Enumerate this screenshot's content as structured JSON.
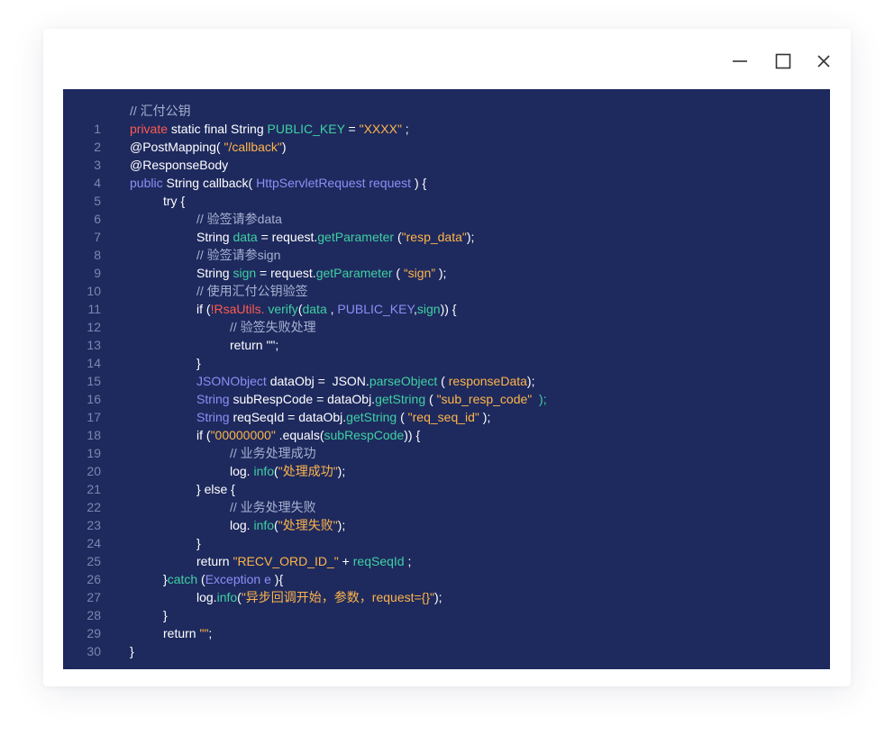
{
  "window": {
    "controls": {
      "minimize": {
        "icon": "minimize-icon"
      },
      "maximize": {
        "icon": "maximize-icon"
      },
      "close": {
        "icon": "close-icon"
      }
    }
  },
  "theme": {
    "editor_bg": "#1e2a5e",
    "plain": "#ffffff",
    "comment": "#a8b0d0",
    "keyword": "#ff5a4e",
    "type": "#8f8df5",
    "function": "#3fd0a2",
    "string": "#ffb44a",
    "line_number": "#7d86ad"
  },
  "code": {
    "lines": [
      {
        "n": "",
        "indent": 0,
        "tokens": [
          {
            "t": "// 汇付公钥",
            "c": "cm"
          }
        ]
      },
      {
        "n": "1",
        "indent": 0,
        "tokens": [
          {
            "t": "private",
            "c": "kw"
          },
          {
            "t": " static final String ",
            "c": "pl"
          },
          {
            "t": "PUBLIC_KEY",
            "c": "fn"
          },
          {
            "t": " = ",
            "c": "pl"
          },
          {
            "t": "\"XXXX\"",
            "c": "str"
          },
          {
            "t": " ;",
            "c": "pl"
          }
        ]
      },
      {
        "n": "2",
        "indent": 0,
        "tokens": [
          {
            "t": "@PostMapping(",
            "c": "pl"
          },
          {
            "t": " \"/callback\"",
            "c": "str"
          },
          {
            "t": ")",
            "c": "pl"
          }
        ]
      },
      {
        "n": "3",
        "indent": 0,
        "tokens": [
          {
            "t": "@ResponseBody",
            "c": "pl"
          }
        ]
      },
      {
        "n": "4",
        "indent": 0,
        "tokens": [
          {
            "t": "public",
            "c": "kw2"
          },
          {
            "t": " String callback( ",
            "c": "pl"
          },
          {
            "t": "HttpServletRequest request",
            "c": "kw2"
          },
          {
            "t": " ) {",
            "c": "pl"
          }
        ]
      },
      {
        "n": "5",
        "indent": 1,
        "tokens": [
          {
            "t": "try {",
            "c": "pl"
          }
        ]
      },
      {
        "n": "6",
        "indent": 2,
        "tokens": [
          {
            "t": "// 验签请参data",
            "c": "cm"
          }
        ]
      },
      {
        "n": "7",
        "indent": 2,
        "tokens": [
          {
            "t": "String ",
            "c": "pl"
          },
          {
            "t": "data",
            "c": "fn"
          },
          {
            "t": " = request.",
            "c": "pl"
          },
          {
            "t": "getParameter",
            "c": "fn"
          },
          {
            "t": " (",
            "c": "pl"
          },
          {
            "t": "\"resp_data\"",
            "c": "str"
          },
          {
            "t": ");",
            "c": "pl"
          }
        ]
      },
      {
        "n": "8",
        "indent": 2,
        "tokens": [
          {
            "t": "// 验签请参sign",
            "c": "cm"
          }
        ]
      },
      {
        "n": "9",
        "indent": 2,
        "tokens": [
          {
            "t": "String ",
            "c": "pl"
          },
          {
            "t": "sign",
            "c": "fn"
          },
          {
            "t": " = request.",
            "c": "pl"
          },
          {
            "t": "getParameter",
            "c": "fn"
          },
          {
            "t": " ( ",
            "c": "pl"
          },
          {
            "t": "“sign”",
            "c": "str"
          },
          {
            "t": " );",
            "c": "pl"
          }
        ]
      },
      {
        "n": "10",
        "indent": 2,
        "tokens": [
          {
            "t": "// 使用汇付公钥验签",
            "c": "cm"
          }
        ]
      },
      {
        "n": "11",
        "indent": 2,
        "tokens": [
          {
            "t": "if (",
            "c": "pl"
          },
          {
            "t": "!RsaUtils.",
            "c": "kw"
          },
          {
            "t": " verify",
            "c": "fn"
          },
          {
            "t": "(",
            "c": "pl"
          },
          {
            "t": "data",
            "c": "fn"
          },
          {
            "t": " , ",
            "c": "pl"
          },
          {
            "t": "PUBLIC_KEY",
            "c": "kw2"
          },
          {
            "t": ",",
            "c": "pl"
          },
          {
            "t": "sign",
            "c": "fn"
          },
          {
            "t": ")) {",
            "c": "pl"
          }
        ]
      },
      {
        "n": "12",
        "indent": 3,
        "tokens": [
          {
            "t": "// 验签失败处理",
            "c": "cm"
          }
        ]
      },
      {
        "n": "13",
        "indent": 3,
        "tokens": [
          {
            "t": "return \"\";",
            "c": "pl"
          }
        ]
      },
      {
        "n": "14",
        "indent": 2,
        "tokens": [
          {
            "t": "}",
            "c": "pl"
          }
        ]
      },
      {
        "n": "15",
        "indent": 2,
        "tokens": [
          {
            "t": "JSONObject",
            "c": "kw2"
          },
          {
            "t": " dataObj =  JSON.",
            "c": "pl"
          },
          {
            "t": "parseObject",
            "c": "fn"
          },
          {
            "t": " ( ",
            "c": "pl"
          },
          {
            "t": "responseData",
            "c": "str"
          },
          {
            "t": ");",
            "c": "pl"
          }
        ]
      },
      {
        "n": "16",
        "indent": 2,
        "tokens": [
          {
            "t": "String",
            "c": "kw2"
          },
          {
            "t": " subRespCode = dataObj.",
            "c": "pl"
          },
          {
            "t": "getString",
            "c": "fn"
          },
          {
            "t": " ( ",
            "c": "pl"
          },
          {
            "t": "\"sub_resp_code\"",
            "c": "str"
          },
          {
            "t": "  );",
            "c": "fn"
          }
        ]
      },
      {
        "n": "17",
        "indent": 2,
        "tokens": [
          {
            "t": "String",
            "c": "kw2"
          },
          {
            "t": " reqSeqId = dataObj.",
            "c": "pl"
          },
          {
            "t": "getString",
            "c": "fn"
          },
          {
            "t": " ( ",
            "c": "pl"
          },
          {
            "t": "\"req_seq_id\"",
            "c": "str"
          },
          {
            "t": " );",
            "c": "pl"
          }
        ]
      },
      {
        "n": "18",
        "indent": 2,
        "tokens": [
          {
            "t": "if (",
            "c": "pl"
          },
          {
            "t": "\"00000000\"",
            "c": "str"
          },
          {
            "t": " .equals(",
            "c": "pl"
          },
          {
            "t": "subRespCode",
            "c": "fn"
          },
          {
            "t": ")) {",
            "c": "pl"
          }
        ]
      },
      {
        "n": "19",
        "indent": 3,
        "tokens": [
          {
            "t": "// 业务处理成功",
            "c": "cm"
          }
        ]
      },
      {
        "n": "20",
        "indent": 3,
        "tokens": [
          {
            "t": "log. ",
            "c": "pl"
          },
          {
            "t": "info",
            "c": "fn"
          },
          {
            "t": "(",
            "c": "pl"
          },
          {
            "t": "\"处理成功\"",
            "c": "str"
          },
          {
            "t": ");",
            "c": "pl"
          }
        ]
      },
      {
        "n": "21",
        "indent": 2,
        "tokens": [
          {
            "t": "} else {",
            "c": "pl"
          }
        ]
      },
      {
        "n": "22",
        "indent": 3,
        "tokens": [
          {
            "t": "// 业务处理失败",
            "c": "cm"
          }
        ]
      },
      {
        "n": "23",
        "indent": 3,
        "tokens": [
          {
            "t": "log. ",
            "c": "pl"
          },
          {
            "t": "info",
            "c": "fn"
          },
          {
            "t": "(",
            "c": "pl"
          },
          {
            "t": "\"处理失败\"",
            "c": "str"
          },
          {
            "t": ");",
            "c": "pl"
          }
        ]
      },
      {
        "n": "24",
        "indent": 2,
        "tokens": [
          {
            "t": "}",
            "c": "pl"
          }
        ]
      },
      {
        "n": "25",
        "indent": 2,
        "tokens": [
          {
            "t": "return ",
            "c": "pl"
          },
          {
            "t": "\"RECV_ORD_ID_\"",
            "c": "str"
          },
          {
            "t": " + ",
            "c": "pl"
          },
          {
            "t": "reqSeqId",
            "c": "fn"
          },
          {
            "t": " ;",
            "c": "pl"
          }
        ]
      },
      {
        "n": "26",
        "indent": 1,
        "tokens": [
          {
            "t": "}",
            "c": "pl"
          },
          {
            "t": "catch",
            "c": "fn"
          },
          {
            "t": " (",
            "c": "pl"
          },
          {
            "t": "Exception e",
            "c": "kw2"
          },
          {
            "t": " ){",
            "c": "pl"
          }
        ]
      },
      {
        "n": "27",
        "indent": 2,
        "tokens": [
          {
            "t": "log.",
            "c": "pl"
          },
          {
            "t": "info",
            "c": "fn"
          },
          {
            "t": "(",
            "c": "pl"
          },
          {
            "t": "\"异步回调开始，参数，request={}\"",
            "c": "str"
          },
          {
            "t": ");",
            "c": "pl"
          }
        ]
      },
      {
        "n": "28",
        "indent": 1,
        "tokens": [
          {
            "t": "}",
            "c": "pl"
          }
        ]
      },
      {
        "n": "29",
        "indent": 1,
        "tokens": [
          {
            "t": "return ",
            "c": "pl"
          },
          {
            "t": "\"\"",
            "c": "str"
          },
          {
            "t": ";",
            "c": "pl"
          }
        ]
      },
      {
        "n": "30",
        "indent": 0,
        "tokens": [
          {
            "t": "}",
            "c": "pl"
          }
        ]
      }
    ]
  }
}
